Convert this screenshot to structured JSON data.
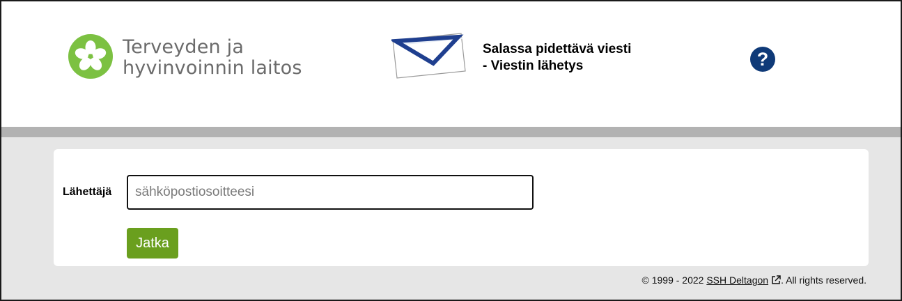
{
  "header": {
    "org_name_line1": "Terveyden ja",
    "org_name_line2": "hyvinvoinnin laitos",
    "title_line1": "Salassa pidettävä viesti",
    "title_line2": "- Viestin lähetys",
    "help_label": "?",
    "icons": {
      "logo": "thl-flower-logo",
      "envelope": "envelope-icon",
      "help": "help-icon"
    }
  },
  "form": {
    "sender_label": "Lähettäjä",
    "email_placeholder": "sähköpostiosoitteesi",
    "email_value": "",
    "continue_label": "Jatka"
  },
  "footer": {
    "copyright_prefix": "© 1999 - 2022",
    "vendor_link": "SSH Deltagon",
    "rights": ". All rights reserved."
  },
  "colors": {
    "brand_green": "#7cc142",
    "button_green": "#6a9f1e",
    "help_blue": "#0f3a78",
    "envelope_blue": "#1f3f8f"
  }
}
